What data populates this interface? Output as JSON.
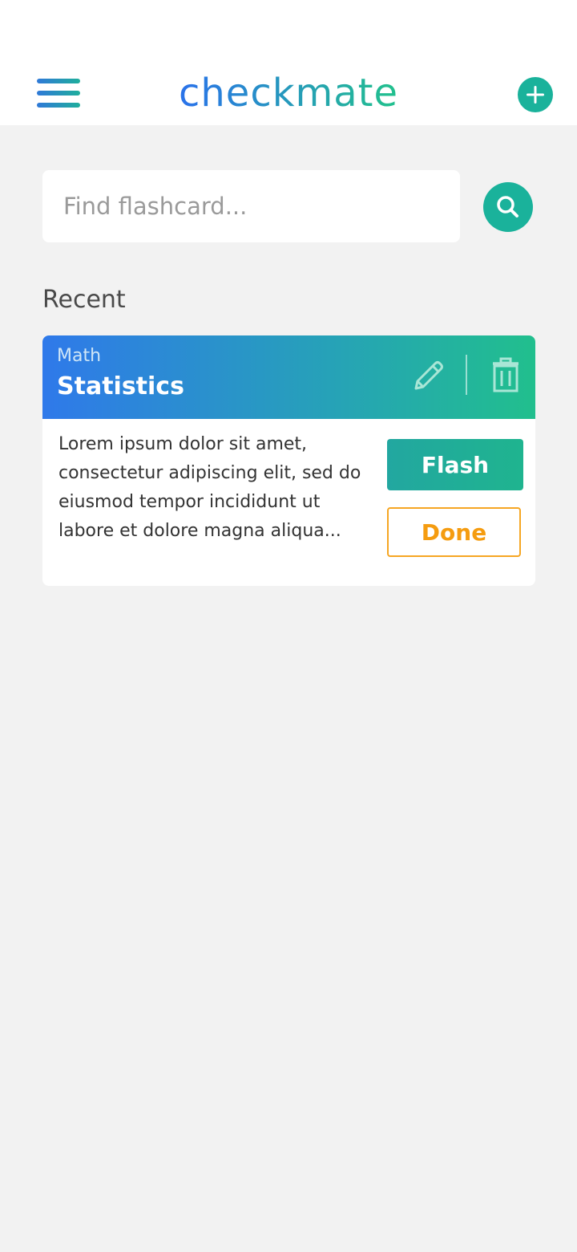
{
  "header": {
    "app_title": "checkmate",
    "menu_icon": "hamburger-menu-icon",
    "add_icon": "plus-circle-icon"
  },
  "search": {
    "placeholder": "Find flashcard...",
    "value": "",
    "button_icon": "search-icon"
  },
  "recent": {
    "section_title": "Recent",
    "cards": [
      {
        "subject": "Math",
        "title": "Statistics",
        "body": "Lorem ipsum dolor sit amet, consectetur adipiscing elit, sed do eiusmod tempor incididunt ut labore et dolore magna aliqua...",
        "edit_icon": "pencil-icon",
        "delete_icon": "trash-icon",
        "flash_label": "Flash",
        "done_label": "Done"
      }
    ]
  },
  "colors": {
    "background": "#f2f2f2",
    "accent_teal": "#1ab29b",
    "gradient_blue": "#2f79ea",
    "gradient_green": "#21bf8d",
    "done_orange": "#f59c10"
  }
}
